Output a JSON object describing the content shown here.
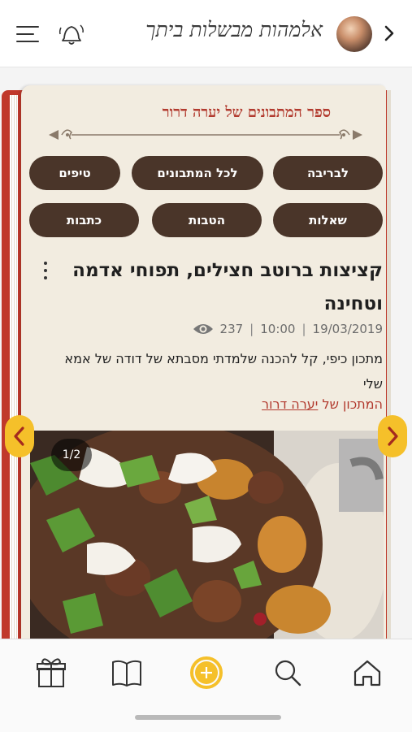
{
  "header": {
    "app_title": "אלמהות מבשלות ביתך",
    "icons": [
      "hamburger-menu-icon",
      "bell-icon",
      "avatar",
      "chevron-right-icon"
    ]
  },
  "book": {
    "title": "ספר המתבונים של יערה דרור",
    "buttons_row1": [
      "לבריבה",
      "לכל המתבונים",
      "טיפים"
    ],
    "buttons_row2": [
      "שאלות",
      "הטבות",
      "כתבות"
    ]
  },
  "recipe": {
    "title": "קציצות ברוטב חצילים, תפוחי אדמה וטחינה",
    "date": "19/03/2019",
    "time": "10:00",
    "views": "237",
    "description": "מתכון כיפי, קל להכנה שלמדתי מסבתא של דודה של אמא שלי",
    "author_prefix": "המתכון של",
    "author_name": "יערה דרור",
    "image_counter": "1/2"
  },
  "tabbar": {
    "tabs": [
      "home-icon",
      "search-icon",
      "add-icon",
      "book-icon",
      "gift-icon"
    ]
  },
  "colors": {
    "accent_red": "#b23a2e",
    "pill_brown": "#4a3529",
    "arrow_yellow": "#f5c02a",
    "paper": "#f2ece0"
  }
}
